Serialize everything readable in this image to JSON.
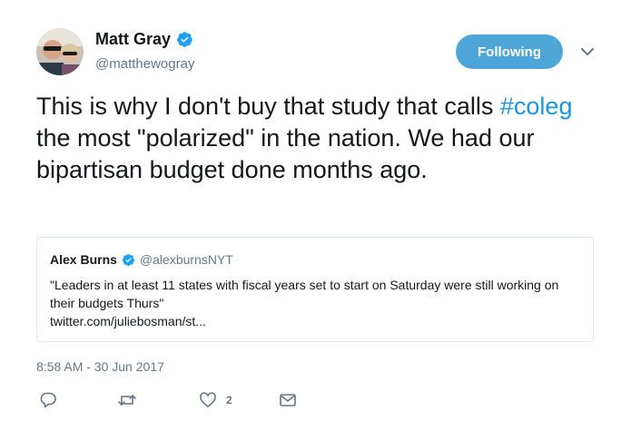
{
  "author": {
    "name": "Matt Gray",
    "handle": "@matthewogray",
    "verified": true
  },
  "follow_button": {
    "label": "Following"
  },
  "tweet": {
    "text_before": "This is why I don't buy that study that calls ",
    "hashtag": "#coleg",
    "text_after": " the most \"polarized\" in the nation. We had our bipartisan budget done months ago."
  },
  "quoted_tweet": {
    "name": "Alex Burns",
    "handle": "@alexburnsNYT",
    "text": "\"Leaders in at least 11 states with fiscal years set to start on Saturday were still working on their budgets Thurs\"",
    "link": "twitter.com/juliebosman/st..."
  },
  "timestamp": "8:58 AM - 30 Jun 2017",
  "actions": {
    "like_count": "2"
  },
  "colors": {
    "accent": "#1b95e0",
    "follow_button": "#4ea6d8",
    "secondary_text": "#657786"
  }
}
